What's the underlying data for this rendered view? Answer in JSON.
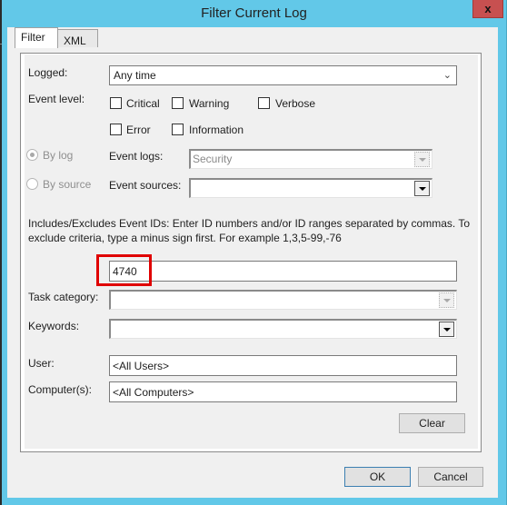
{
  "window": {
    "title": "Filter Current Log",
    "close_glyph": "x"
  },
  "tabs": [
    {
      "label": "Filter",
      "active": true
    },
    {
      "label": "XML",
      "active": false
    }
  ],
  "form": {
    "logged": {
      "label": "Logged:",
      "value": "Any time"
    },
    "event_level": {
      "label": "Event level:",
      "options": [
        {
          "label": "Critical",
          "checked": false
        },
        {
          "label": "Warning",
          "checked": false
        },
        {
          "label": "Verbose",
          "checked": false
        },
        {
          "label": "Error",
          "checked": false
        },
        {
          "label": "Information",
          "checked": false
        }
      ]
    },
    "source_mode": {
      "by_log": {
        "label": "By log",
        "selected": true,
        "enabled": false
      },
      "by_source": {
        "label": "By source",
        "selected": false,
        "enabled": false
      }
    },
    "event_logs": {
      "label": "Event logs:",
      "value": "Security",
      "enabled": false
    },
    "event_sources": {
      "label": "Event sources:",
      "value": "",
      "enabled": true
    },
    "event_ids": {
      "description": "Includes/Excludes Event IDs: Enter ID numbers and/or ID ranges separated by commas. To exclude criteria, type a minus sign first. For example 1,3,5-99,-76",
      "value": "4740",
      "highlight_color": "#e00000"
    },
    "task_category": {
      "label": "Task category:",
      "value": "",
      "enabled": false
    },
    "keywords": {
      "label": "Keywords:",
      "value": "",
      "enabled": true
    },
    "user": {
      "label": "User:",
      "value": "<All Users>"
    },
    "computers": {
      "label": "Computer(s):",
      "value": "<All Computers>"
    },
    "clear_label": "Clear"
  },
  "footer": {
    "ok_label": "OK",
    "cancel_label": "Cancel"
  },
  "colors": {
    "frame": "#62c8e8",
    "close": "#c75050",
    "background": "#f0f0f0"
  }
}
